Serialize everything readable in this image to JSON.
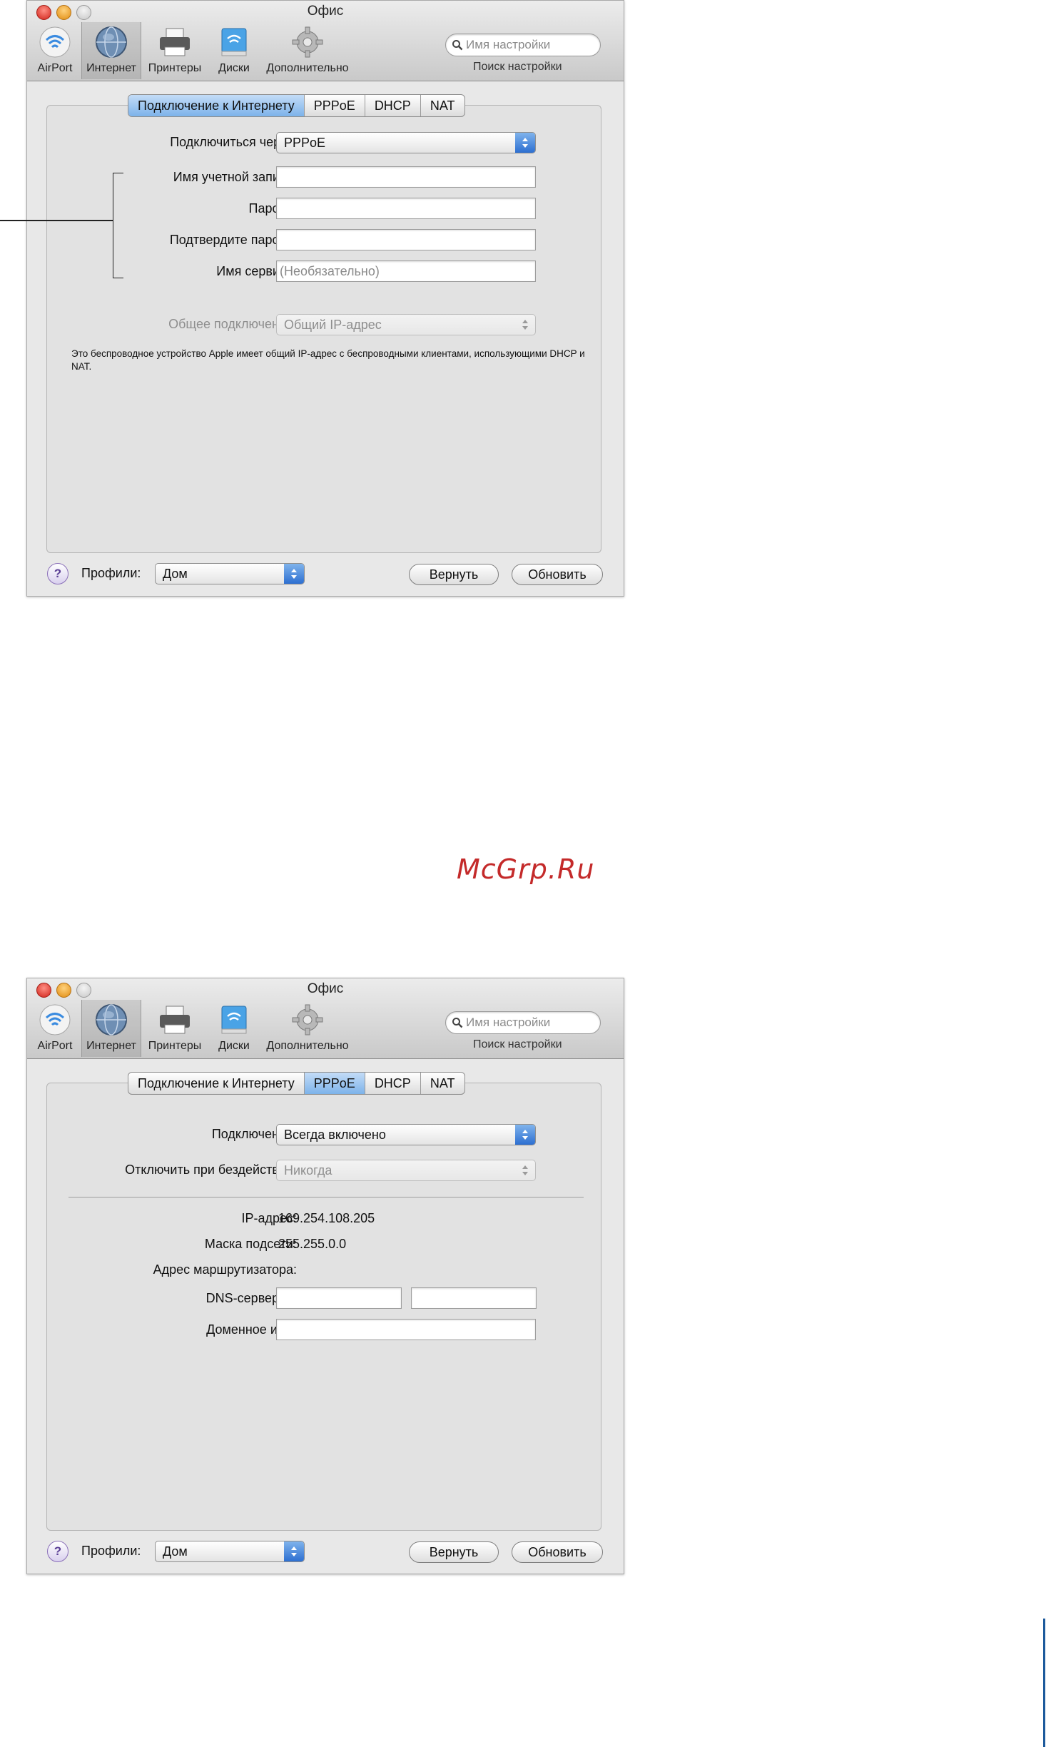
{
  "screens": [
    {
      "window_title": "Офис",
      "toolbar": [
        {
          "label": "AirPort",
          "icon": "airport-icon"
        },
        {
          "label": "Интернет",
          "icon": "globe-icon"
        },
        {
          "label": "Принтеры",
          "icon": "printer-icon"
        },
        {
          "label": "Диски",
          "icon": "disk-icon"
        },
        {
          "label": "Дополнительно",
          "icon": "gear-icon"
        }
      ],
      "search": {
        "placeholder": "Имя настройки",
        "caption": "Поиск настройки"
      },
      "tabs": [
        "Подключение к Интернету",
        "PPPoE",
        "DHCP",
        "NAT"
      ],
      "active_tab": "Подключение к Интернету",
      "connect_via": {
        "label": "Подключиться через:",
        "value": "PPPoE"
      },
      "account_name": {
        "label": "Имя учетной записи:",
        "value": ""
      },
      "password": {
        "label": "Пароль:",
        "value": ""
      },
      "confirm_password": {
        "label": "Подтвердите пароль:",
        "value": ""
      },
      "service_name": {
        "label": "Имя сервиса:",
        "placeholder": "(Необязательно)"
      },
      "sharing": {
        "label": "Общее подключение:",
        "value": "Общий IP-адрес"
      },
      "note": "Это беспроводное устройство Apple имеет общий IP-адрес с беспроводными клиентами, использующими DHCP и NAT.",
      "footer": {
        "profiles_label": "Профили:",
        "profile_value": "Дом",
        "revert_label": "Вернуть",
        "update_label": "Обновить",
        "help_label": "?"
      }
    },
    {
      "window_title": "Офис",
      "toolbar": [
        {
          "label": "AirPort",
          "icon": "airport-icon"
        },
        {
          "label": "Интернет",
          "icon": "globe-icon"
        },
        {
          "label": "Принтеры",
          "icon": "printer-icon"
        },
        {
          "label": "Диски",
          "icon": "disk-icon"
        },
        {
          "label": "Дополнительно",
          "icon": "gear-icon"
        }
      ],
      "search": {
        "placeholder": "Имя настройки",
        "caption": "Поиск настройки"
      },
      "tabs": [
        "Подключение к Интернету",
        "PPPoE",
        "DHCP",
        "NAT"
      ],
      "active_tab": "PPPoE",
      "connection": {
        "label": "Подключение:",
        "value": "Всегда включено"
      },
      "disconnect_idle": {
        "label": "Отключить при бездействии:",
        "value": "Никогда"
      },
      "ip_address": {
        "label": "IP-адрес:",
        "value": "169.254.108.205"
      },
      "subnet_mask": {
        "label": "Маска подсети:",
        "value": "255.255.0.0"
      },
      "router_address": {
        "label": "Адрес маршрутизатора:",
        "value": ""
      },
      "dns_servers": {
        "label": "DNS-сервер(ы)",
        "value1": "",
        "value2": ""
      },
      "domain_name": {
        "label": "Доменное имя:",
        "value": ""
      },
      "footer": {
        "profiles_label": "Профили:",
        "profile_value": "Дом",
        "revert_label": "Вернуть",
        "update_label": "Обновить",
        "help_label": "?"
      }
    }
  ],
  "watermark": "McGrp.Ru",
  "colors": {
    "watermark": "#c42a2a",
    "tab_active": "#7db3ea",
    "popup_arrow": "#2d6fd1"
  }
}
